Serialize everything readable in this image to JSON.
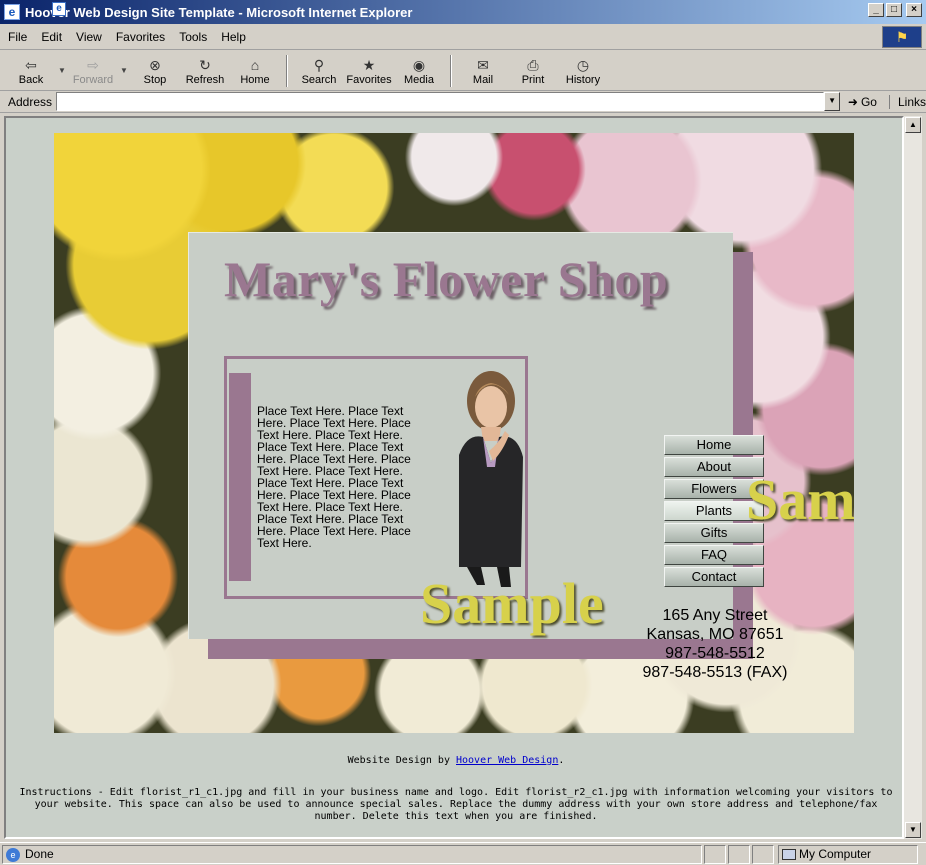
{
  "window": {
    "title": "Hoover Web Design Site Template - Microsoft Internet Explorer",
    "controls": {
      "minimize": "_",
      "maximize": "□",
      "close": "×"
    }
  },
  "menu": [
    {
      "label": "File",
      "key": "F"
    },
    {
      "label": "Edit",
      "key": "E"
    },
    {
      "label": "View",
      "key": "V"
    },
    {
      "label": "Favorites",
      "key": "a"
    },
    {
      "label": "Tools",
      "key": "T"
    },
    {
      "label": "Help",
      "key": "H"
    }
  ],
  "toolbar": {
    "back": "Back",
    "forward": "Forward",
    "stop": "Stop",
    "refresh": "Refresh",
    "home": "Home",
    "search": "Search",
    "favorites": "Favorites",
    "media": "Media",
    "mail": "Mail",
    "print": "Print",
    "history": "History"
  },
  "address": {
    "label": "Address",
    "value": "",
    "go": "Go",
    "links": "Links"
  },
  "page": {
    "shop_title": "Mary's Flower Shop",
    "placeholder": "Place Text Here. Place Text Here. Place Text Here. Place Text Here. Place Text Here. Place Text Here. Place Text Here. Place Text Here. Place Text Here. Place Text Here. Place Text Here. Place Text Here. Place Text Here. Place Text Here. Place Text Here. Place Text Here. Place Text Here. Place Text Here. Place Text Here.",
    "watermark": "Sample",
    "nav": [
      "Home",
      "About",
      "Flowers",
      "Plants",
      "Gifts",
      "FAQ",
      "Contact"
    ],
    "active_nav": "Plants",
    "contact": {
      "street": "165 Any Street",
      "city": "Kansas, MO 87651",
      "phone": "987-548-5512",
      "fax": "987-548-5513 (FAX)"
    },
    "credit_prefix": "Website Design by",
    "credit_link": "Hoover Web Design",
    "credit_suffix": ".",
    "instructions": "Instructions - Edit florist_r1_c1.jpg and fill in your business name and logo. Edit florist_r2_c1.jpg with information welcoming your visitors to your website. This space can also be used to announce special sales. Replace the dummy address with your own store address and telephone/fax number. Delete this text when you are finished."
  },
  "status": {
    "text": "Done",
    "zone": "My Computer"
  },
  "colors": {
    "accent_mauve": "#9a7790",
    "panel_bg": "#c8cec7",
    "watermark": "#d7d14b",
    "link": "#0000cc"
  }
}
